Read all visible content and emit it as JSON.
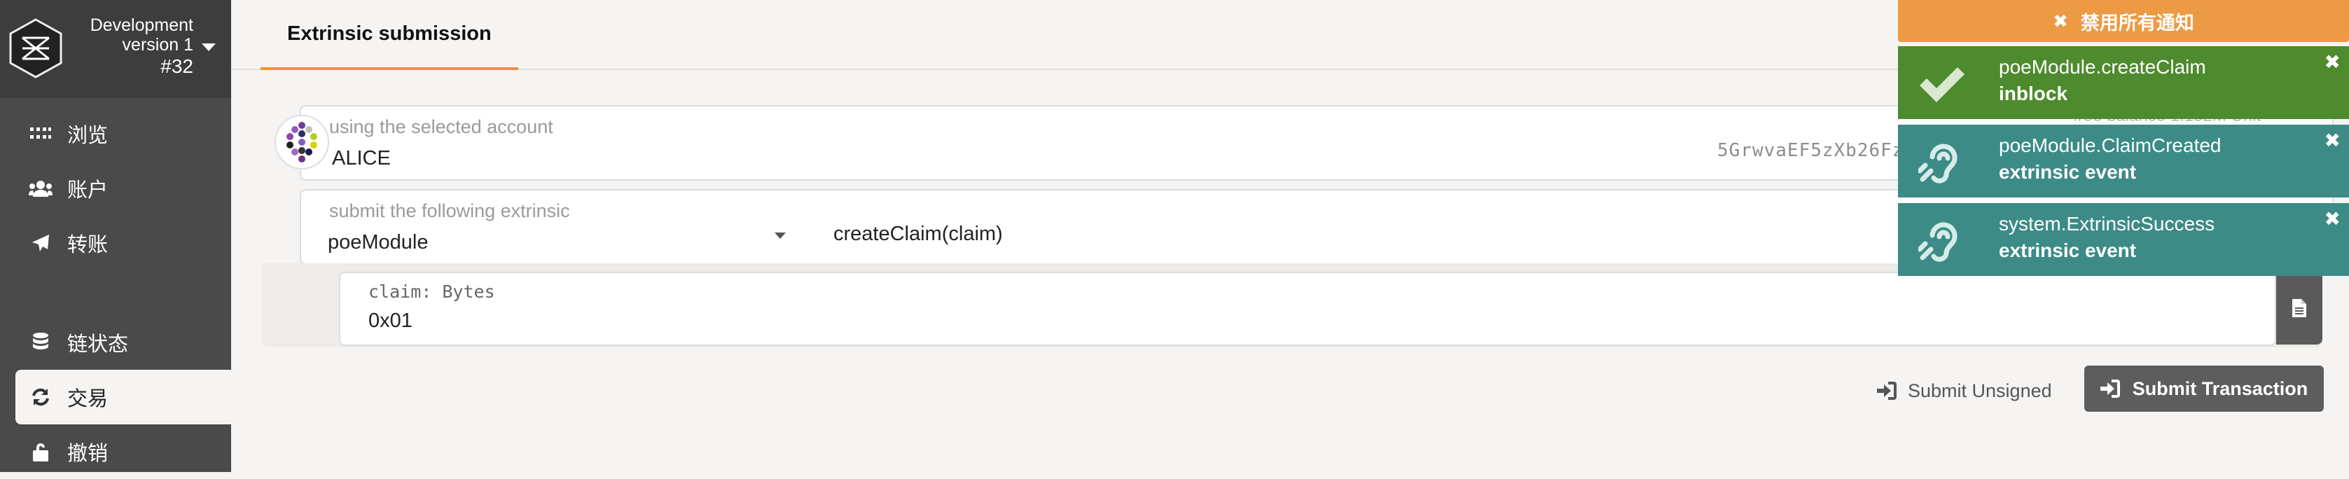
{
  "sidebar": {
    "chain": {
      "name": "Development",
      "version": "version 1",
      "block": "#32"
    },
    "items": [
      {
        "label": "浏览",
        "icon": "dots-grid-icon"
      },
      {
        "label": "账户",
        "icon": "users-icon"
      },
      {
        "label": "转账",
        "icon": "paper-plane-icon"
      },
      {
        "label": "链状态",
        "icon": "database-icon"
      },
      {
        "label": "交易",
        "icon": "sync-icon"
      },
      {
        "label": "撤销",
        "icon": "unlock-icon"
      }
    ],
    "active": "交易"
  },
  "header": {
    "tab": "Extrinsic submission"
  },
  "form": {
    "account": {
      "label": "using the selected account",
      "value": "ALICE",
      "address": "5GrwvaEF5zXb26Fz",
      "ghost": "free balance 1.152M Unit"
    },
    "extrinsic": {
      "label": "submit the following extrinsic",
      "module": "poeModule",
      "method": "createClaim(claim)"
    },
    "param": {
      "label": "claim: Bytes",
      "value": "0x01"
    },
    "buttons": {
      "unsigned": "Submit Unsigned",
      "submit": "Submit Transaction"
    }
  },
  "notifications": {
    "dismiss_all": "禁用所有通知",
    "toasts": [
      {
        "title": "poeModule.createClaim",
        "status": "inblock",
        "icon": "check-icon",
        "color": "#4e8b2e"
      },
      {
        "title": "poeModule.ClaimCreated",
        "status": "extrinsic event",
        "icon": "ear-icon",
        "color": "#3c8b86"
      },
      {
        "title": "system.ExtrinsicSuccess",
        "status": "extrinsic event",
        "icon": "ear-icon",
        "color": "#3c8b86"
      }
    ]
  },
  "colors": {
    "accent": "#f19135",
    "sidebar": "#4a4a4a",
    "success": "#4e8b2e",
    "event": "#3c8b86"
  }
}
